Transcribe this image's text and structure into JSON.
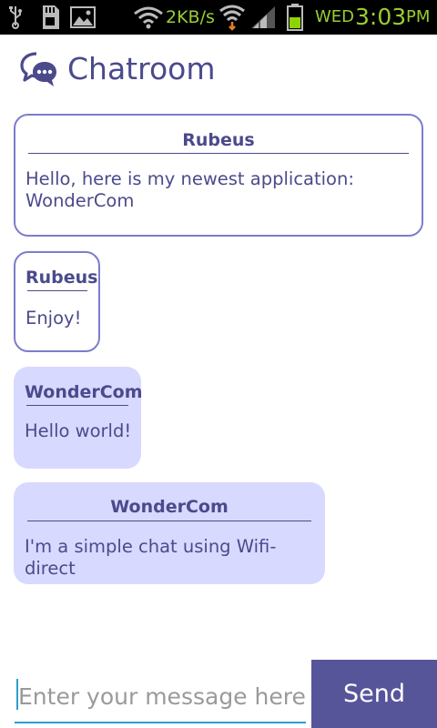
{
  "status_bar": {
    "left_icons": [
      "usb-icon",
      "sd-card-icon",
      "image-icon"
    ],
    "wifi_speed": "2KB/s",
    "day": "WED",
    "time": "3:03",
    "ampm": "PM",
    "colors": {
      "background": "#000000",
      "text": "#9acd32"
    }
  },
  "header": {
    "title": "Chatroom",
    "icon": "chat-bubbles-icon",
    "color": "#4b4a8c"
  },
  "messages": [
    {
      "author": "Rubeus",
      "text": "Hello, here is my newest application: WonderCom",
      "type": "outgoing"
    },
    {
      "author": "Rubeus",
      "text": "Enjoy!",
      "type": "outgoing"
    },
    {
      "author": "WonderCom",
      "text": "Hello world!",
      "type": "incoming"
    },
    {
      "author": "WonderCom",
      "text": "I'm a simple chat using Wifi-direct",
      "type": "incoming"
    }
  ],
  "composer": {
    "placeholder": "Enter your message here",
    "value": "",
    "send_label": "Send",
    "send_color": "#56559a",
    "input_underline_color": "#2f9ec9"
  },
  "colors": {
    "outgoing_border": "#7c7ccc",
    "incoming_fill": "#d8d9ff",
    "text": "#4b4a8c"
  }
}
